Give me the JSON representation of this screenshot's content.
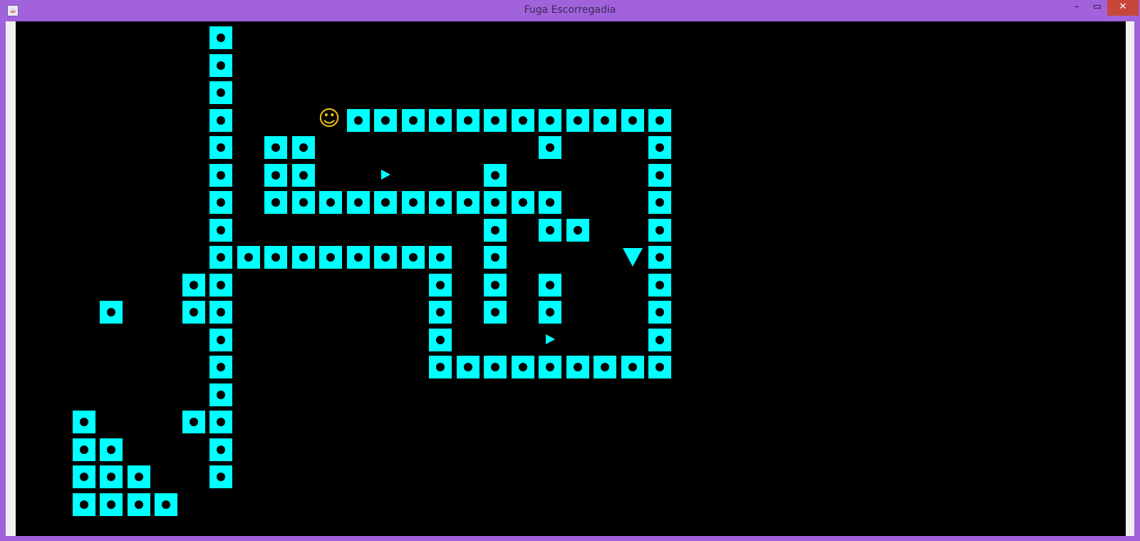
{
  "window": {
    "title": "Fuga Escorregadia",
    "icon": "java-cup-icon",
    "controls": {
      "minimize": "–",
      "maximize": "▭",
      "close": "✕"
    }
  },
  "colors": {
    "background": "#000000",
    "wall": "#00ffff",
    "wall_dot": "#000000",
    "player": "#f2c40e",
    "enemy": "#00ffff",
    "titlebar": "#a162dc"
  },
  "board": {
    "cols": 40,
    "rows": 18,
    "walls": [
      [
        6,
        0
      ],
      [
        6,
        1
      ],
      [
        6,
        2
      ],
      [
        6,
        3
      ],
      [
        11,
        3
      ],
      [
        12,
        3
      ],
      [
        13,
        3
      ],
      [
        14,
        3
      ],
      [
        15,
        3
      ],
      [
        16,
        3
      ],
      [
        17,
        3
      ],
      [
        18,
        3
      ],
      [
        19,
        3
      ],
      [
        20,
        3
      ],
      [
        21,
        3
      ],
      [
        22,
        3
      ],
      [
        6,
        4
      ],
      [
        8,
        4
      ],
      [
        9,
        4
      ],
      [
        18,
        4
      ],
      [
        22,
        4
      ],
      [
        6,
        5
      ],
      [
        8,
        5
      ],
      [
        9,
        5
      ],
      [
        16,
        5
      ],
      [
        22,
        5
      ],
      [
        6,
        6
      ],
      [
        8,
        6
      ],
      [
        9,
        6
      ],
      [
        10,
        6
      ],
      [
        11,
        6
      ],
      [
        12,
        6
      ],
      [
        13,
        6
      ],
      [
        14,
        6
      ],
      [
        15,
        6
      ],
      [
        16,
        6
      ],
      [
        17,
        6
      ],
      [
        18,
        6
      ],
      [
        22,
        6
      ],
      [
        6,
        7
      ],
      [
        16,
        7
      ],
      [
        18,
        7
      ],
      [
        19,
        7
      ],
      [
        22,
        7
      ],
      [
        6,
        8
      ],
      [
        7,
        8
      ],
      [
        8,
        8
      ],
      [
        9,
        8
      ],
      [
        10,
        8
      ],
      [
        11,
        8
      ],
      [
        12,
        8
      ],
      [
        13,
        8
      ],
      [
        14,
        8
      ],
      [
        16,
        8
      ],
      [
        22,
        8
      ],
      [
        5,
        9
      ],
      [
        6,
        9
      ],
      [
        14,
        9
      ],
      [
        16,
        9
      ],
      [
        18,
        9
      ],
      [
        22,
        9
      ],
      [
        2,
        10
      ],
      [
        5,
        10
      ],
      [
        6,
        10
      ],
      [
        14,
        10
      ],
      [
        16,
        10
      ],
      [
        18,
        10
      ],
      [
        22,
        10
      ],
      [
        6,
        11
      ],
      [
        14,
        11
      ],
      [
        22,
        11
      ],
      [
        6,
        12
      ],
      [
        14,
        12
      ],
      [
        15,
        12
      ],
      [
        16,
        12
      ],
      [
        17,
        12
      ],
      [
        18,
        12
      ],
      [
        19,
        12
      ],
      [
        20,
        12
      ],
      [
        21,
        12
      ],
      [
        22,
        12
      ],
      [
        6,
        13
      ],
      [
        1,
        14
      ],
      [
        5,
        14
      ],
      [
        6,
        14
      ],
      [
        1,
        15
      ],
      [
        2,
        15
      ],
      [
        6,
        15
      ],
      [
        1,
        16
      ],
      [
        2,
        16
      ],
      [
        3,
        16
      ],
      [
        6,
        16
      ],
      [
        1,
        17
      ],
      [
        2,
        17
      ],
      [
        3,
        17
      ],
      [
        4,
        17
      ]
    ],
    "player": {
      "col": 10,
      "row": 3,
      "glyph": "☺"
    },
    "enemies": [
      {
        "col": 12,
        "row": 5,
        "facing": "right",
        "size": "small"
      },
      {
        "col": 18,
        "row": 11,
        "facing": "right",
        "size": "small"
      },
      {
        "col": 21,
        "row": 8,
        "facing": "down",
        "size": "large"
      }
    ]
  }
}
